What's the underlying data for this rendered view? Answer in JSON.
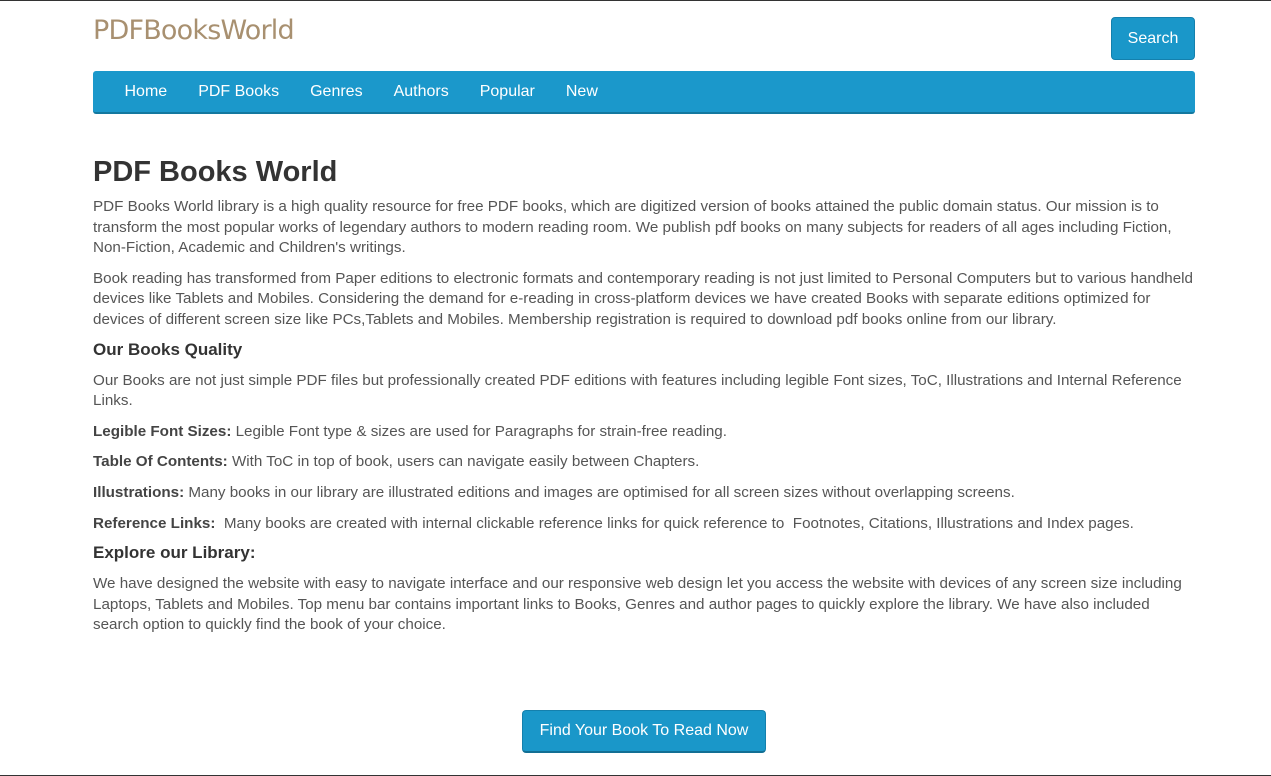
{
  "header": {
    "logo": "PDFBooksWorld",
    "search_label": "Search"
  },
  "nav": {
    "items": [
      "Home",
      "PDF Books",
      "Genres",
      "Authors",
      "Popular",
      "New"
    ]
  },
  "main": {
    "title": "PDF Books World",
    "intro_p1": "PDF Books World library is a high quality resource for free PDF books, which are digitized version of books attained the public domain status. Our mission is to transform the most popular works of legendary authors to modern reading room. We publish pdf books on many subjects for readers of all ages including Fiction, Non-Fiction, Academic and Children's writings.",
    "intro_p2": "Book reading has transformed from Paper editions to electronic formats and contemporary reading is not just limited to Personal Computers but to various handheld devices like Tablets and Mobiles. Considering the demand for e-reading in cross-platform devices we have created Books with separate editions optimized for devices of different screen size like PCs,Tablets and Mobiles. Membership registration is required to download pdf books online from our library.",
    "quality_heading": "Our Books Quality",
    "quality_p": "Our Books are not just simple PDF files but professionally created PDF editions with features including legible Font sizes, ToC, Illustrations and Internal Reference Links.",
    "features": [
      {
        "label": "Legible Font Sizes:",
        "text": " Legible Font type & sizes are used for Paragraphs for strain-free reading."
      },
      {
        "label": "Table Of Contents:",
        "text": " With ToC in top of book, users can navigate easily between Chapters."
      },
      {
        "label": "Illustrations:",
        "text": " Many books in our library are illustrated editions and images are optimised for all screen sizes without overlapping screens."
      },
      {
        "label": "Reference Links:",
        "text": "  Many books are created with internal clickable reference links for quick reference to  Footnotes, Citations, Illustrations and Index pages."
      }
    ],
    "explore_heading": "Explore our Library:",
    "explore_p": "We have designed the website with easy to navigate interface  and our responsive web design let you access the website with devices of any screen size including Laptops, Tablets and Mobiles. Top menu bar contains important links to Books, Genres and author pages to quickly explore the library. We have also included search option to quickly find the book of your choice.",
    "cta_label": "Find Your Book To Read Now"
  },
  "colors": {
    "accent": "#1b98cb",
    "logo": "#a89070"
  }
}
